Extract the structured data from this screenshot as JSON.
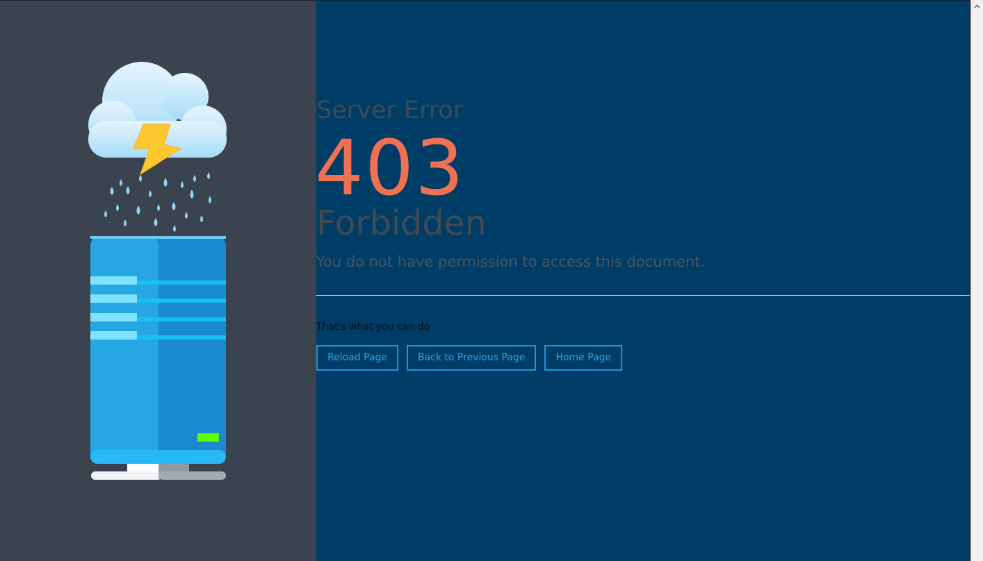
{
  "error": {
    "heading": "Server Error",
    "code": "403",
    "reason": "Forbidden",
    "message": "You do not have permission to access this document."
  },
  "actions": {
    "heading": "That's what you can do",
    "reload_label": "Reload Page",
    "back_label": "Back to Previous Page",
    "home_label": "Home Page"
  },
  "colors": {
    "left_panel": "#3a434e",
    "right_panel": "#003d66",
    "code": "#f07052",
    "heading_text": "#3f4a55",
    "button_border": "#1e95d6",
    "button_text": "#2aa3e4"
  },
  "icons": {
    "illustration": "server-storm-illustration",
    "scroll_up": "chevron-up-icon"
  }
}
